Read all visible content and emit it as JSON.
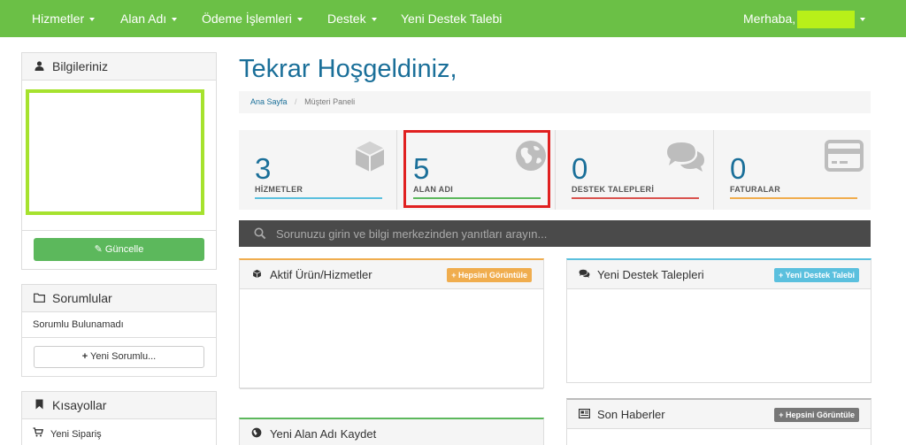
{
  "nav": {
    "services": "Hizmetler",
    "domains": "Alan Adı",
    "billing": "Ödeme İşlemleri",
    "support": "Destek",
    "new_ticket": "Yeni Destek Talebi",
    "greeting": "Merhaba,"
  },
  "sidebar": {
    "info_title": "Bilgileriniz",
    "update_button": "Güncelle",
    "contacts_title": "Sorumlular",
    "contacts_empty": "Sorumlu Bulunamadı",
    "new_contact_button": "Yeni Sorumlu...",
    "shortcuts_title": "Kısayollar",
    "shortcut_new_order": "Yeni Sipariş"
  },
  "main": {
    "title": "Tekrar Hoşgeldiniz,",
    "breadcrumb_home": "Ana Sayfa",
    "breadcrumb_current": "Müşteri Paneli",
    "search_placeholder": "Sorunuzu girin ve bilgi merkezinden yanıtları arayın...",
    "stats": [
      {
        "count": "3",
        "label": "HİZMETLER",
        "color": "#5bc0de",
        "icon": "cube-icon"
      },
      {
        "count": "5",
        "label": "ALAN ADI",
        "color": "#5cb85c",
        "icon": "globe-icon"
      },
      {
        "count": "0",
        "label": "DESTEK TALEPLERİ",
        "color": "#d9534f",
        "icon": "comments-icon"
      },
      {
        "count": "0",
        "label": "FATURALAR",
        "color": "#f0ad4e",
        "icon": "credit-card-icon"
      }
    ],
    "active_services": {
      "title": "Aktif Ürün/Hizmetler",
      "button": "Hepsini Görüntüle",
      "accent": "#f0ad4e"
    },
    "recent_tickets": {
      "title": "Yeni Destek Talepleri",
      "button": "Yeni Destek Talebi",
      "accent": "#5bc0de"
    },
    "register_domain": {
      "title": "Yeni Alan Adı Kaydet",
      "accent": "#5cb85c"
    },
    "news": {
      "title": "Son Haberler",
      "button": "Hepsini Görüntüle",
      "accent": "#777777"
    }
  }
}
